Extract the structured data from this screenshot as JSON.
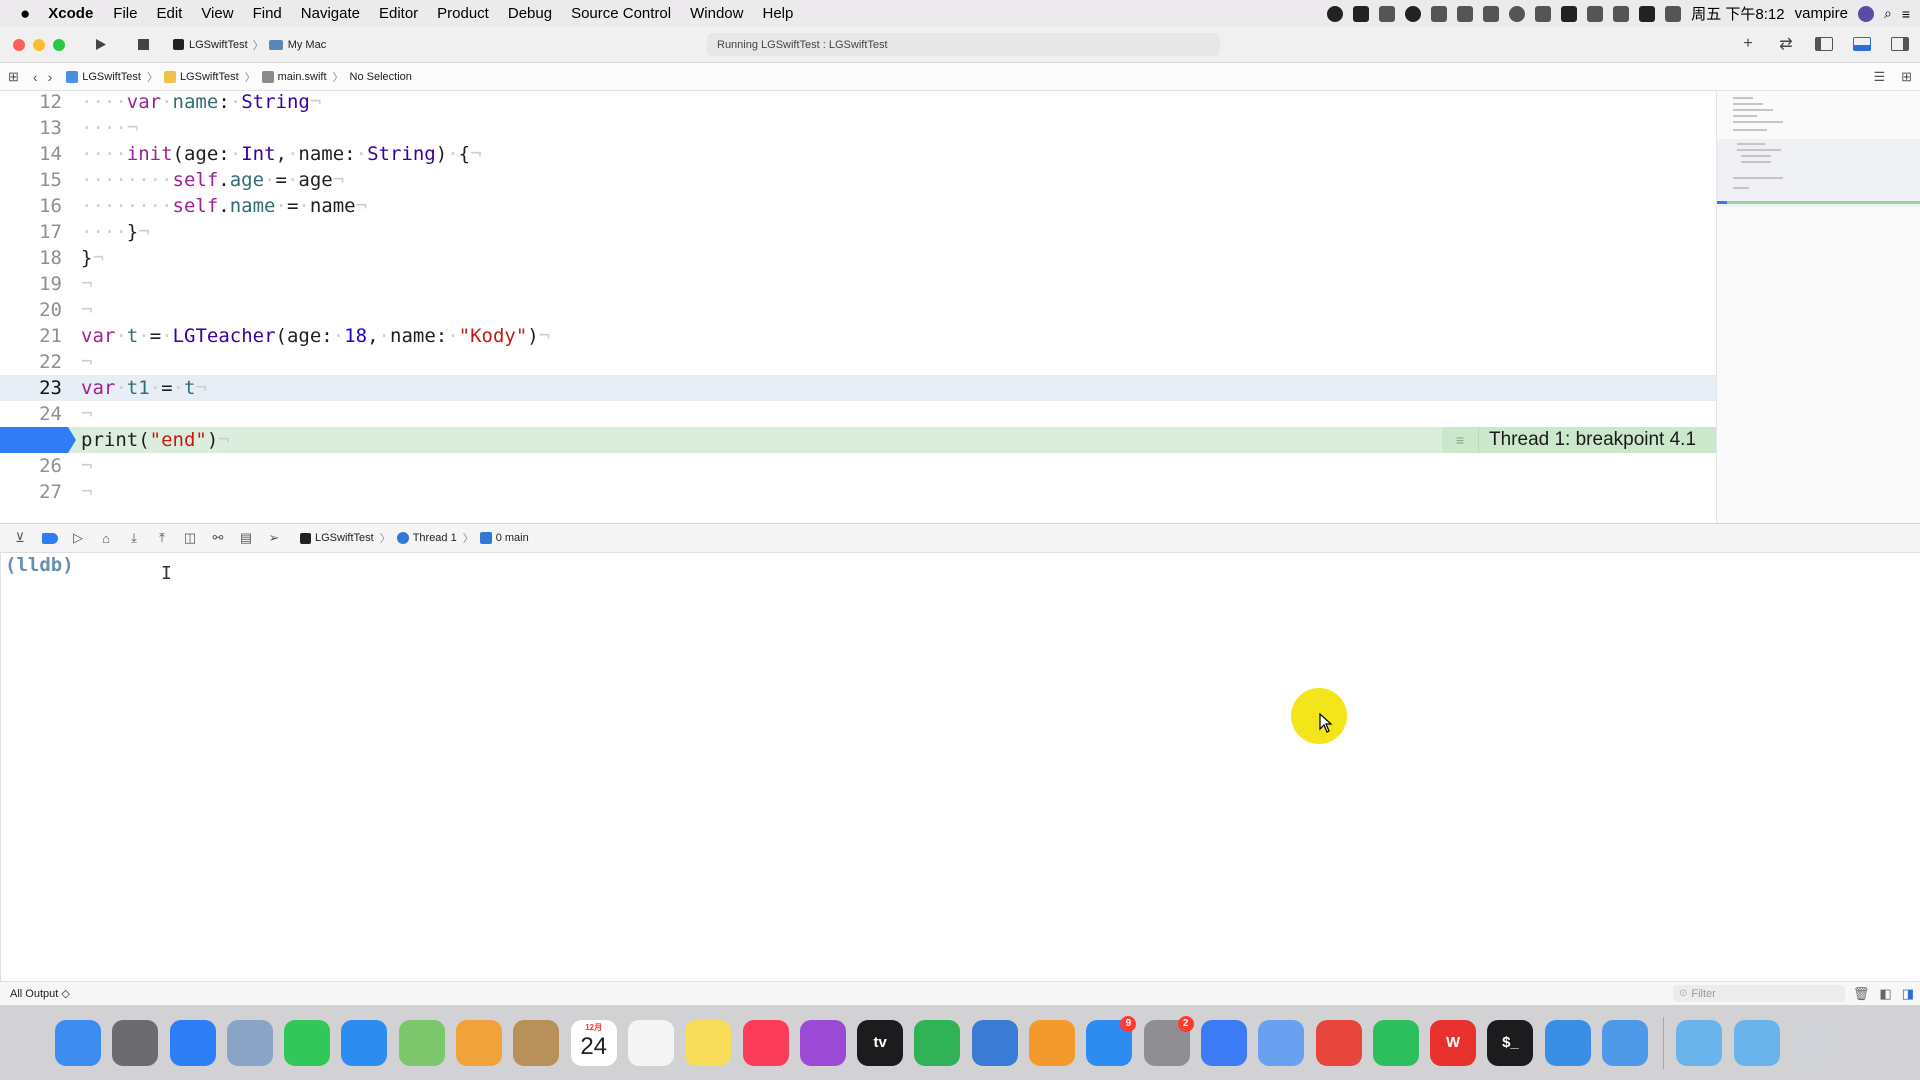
{
  "menubar": {
    "apple": "",
    "app_name": "Xcode",
    "menus": [
      "File",
      "Edit",
      "View",
      "Find",
      "Navigate",
      "Editor",
      "Product",
      "Debug",
      "Source Control",
      "Window",
      "Help"
    ],
    "clock": "周五 下午8:12",
    "user": "vampire",
    "status_icons": [
      "app-icon",
      "wps-icon",
      "pen-icon",
      "record-icon",
      "plane-icon",
      "v-icon",
      "tool-icon",
      "circle-icon",
      "airdrop-icon",
      "info-icon",
      "display-icon",
      "bluetooth-icon",
      "du-icon",
      "wifi-icon"
    ]
  },
  "toolbar": {
    "scheme_name": "LGSwiftTest",
    "destination": "My Mac",
    "activity": "Running LGSwiftTest : LGSwiftTest"
  },
  "jumpbar": {
    "crumbs": [
      "LGSwiftTest",
      "LGSwiftTest",
      "main.swift",
      "No Selection"
    ]
  },
  "editor": {
    "line_numbers": [
      "12",
      "13",
      "14",
      "15",
      "16",
      "17",
      "18",
      "19",
      "20",
      "21",
      "22",
      "23",
      "24",
      "25",
      "26",
      "27"
    ],
    "current_line": "23",
    "breakpoint_line": "25",
    "breakpoint_annotation": "Thread 1: breakpoint 4.1"
  },
  "debugbar": {
    "crumbs": [
      "LGSwiftTest",
      "Thread 1",
      "0 main"
    ]
  },
  "console": {
    "prompt": "(lldb)",
    "output_selector": "All Output ◇",
    "filter_placeholder": "Filter"
  },
  "dock": {
    "apps": [
      {
        "name": "finder-icon",
        "color": "#3d8cf0"
      },
      {
        "name": "launchpad-icon",
        "color": "#6c6c70"
      },
      {
        "name": "safari-icon",
        "color": "#2d7df6"
      },
      {
        "name": "preview-icon",
        "color": "#8aa4c8"
      },
      {
        "name": "facetime-icon",
        "color": "#32c759"
      },
      {
        "name": "messages-icon",
        "color": "#2d8cf0"
      },
      {
        "name": "maps-icon",
        "color": "#7cc76b"
      },
      {
        "name": "photos-icon",
        "color": "#f2a23a"
      },
      {
        "name": "contacts-icon",
        "color": "#b8915a"
      },
      {
        "name": "calendar-icon",
        "color": "#ffffff",
        "month": "12月",
        "day": "24"
      },
      {
        "name": "reminders-icon",
        "color": "#f5f5f5"
      },
      {
        "name": "notes-icon",
        "color": "#f7dd5a"
      },
      {
        "name": "music-icon",
        "color": "#fa3c5a"
      },
      {
        "name": "podcasts-icon",
        "color": "#9b4ad6"
      },
      {
        "name": "apple-tv-icon",
        "color": "#1c1c1e",
        "label": "tv"
      },
      {
        "name": "numbers-icon",
        "color": "#2fb356"
      },
      {
        "name": "keynote-icon",
        "color": "#3a7bd5"
      },
      {
        "name": "pages-icon",
        "color": "#f29a2e"
      },
      {
        "name": "app-store-icon",
        "color": "#2d8cf0",
        "badge": "9"
      },
      {
        "name": "system-preferences-icon",
        "color": "#8e8e93",
        "badge": "2"
      },
      {
        "name": "feishu-icon",
        "color": "#3b7cf5"
      },
      {
        "name": "paper-plane-icon",
        "color": "#6aa0f0"
      },
      {
        "name": "chrome-icon",
        "color": "#e8453c"
      },
      {
        "name": "evernote-icon",
        "color": "#2dbe60"
      },
      {
        "name": "wps-icon",
        "color": "#e8302e",
        "label": "W"
      },
      {
        "name": "terminal-icon",
        "color": "#1c1c1e",
        "label": "$_"
      },
      {
        "name": "xcode-icon",
        "color": "#3a8ee6"
      },
      {
        "name": "instruments-icon",
        "color": "#4f9ae8"
      }
    ],
    "right_items": [
      {
        "name": "downloads-folder-icon",
        "color": "#6ab4ec"
      },
      {
        "name": "applications-folder-icon",
        "color": "#6ab4ec"
      },
      {
        "name": "trash-icon",
        "color": "#cfd2d6"
      }
    ]
  }
}
